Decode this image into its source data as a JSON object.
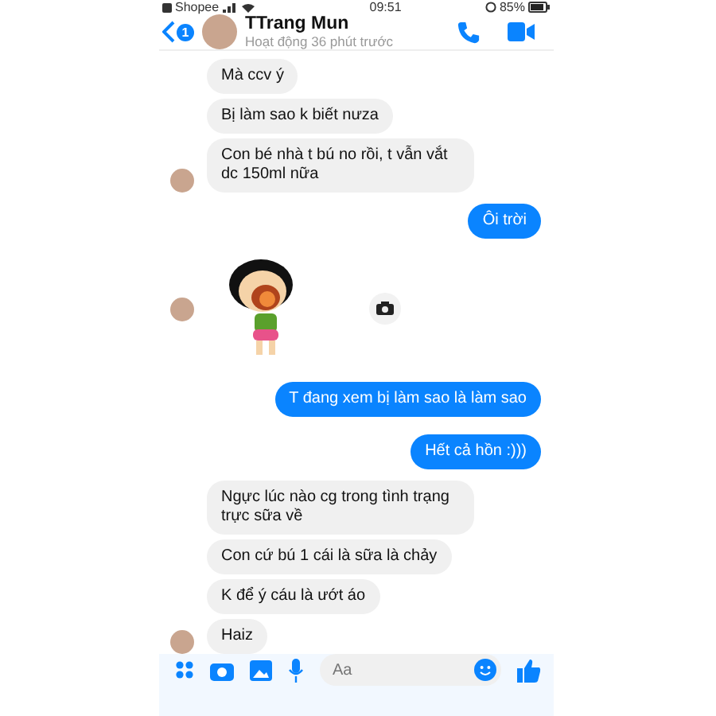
{
  "status_bar": {
    "carrier": "Shopee",
    "time": "09:51",
    "battery": "85%"
  },
  "header": {
    "unread_badge": "1",
    "name": "TTrang Mun",
    "status": "Hoạt động 36 phút trước"
  },
  "messages": [
    {
      "kind": "text",
      "sent": false,
      "avatar": false,
      "text": "Mà ccv ý"
    },
    {
      "kind": "text",
      "sent": false,
      "avatar": false,
      "text": "Bị làm sao k biết nưza"
    },
    {
      "kind": "text",
      "sent": false,
      "avatar": true,
      "text": "Con bé nhà t bú no rồi, t vẫn vắt dc 150ml nữa"
    },
    {
      "kind": "text",
      "sent": true,
      "text": "Ôi trời"
    },
    {
      "kind": "sticker",
      "sent": false,
      "avatar": true
    },
    {
      "kind": "text",
      "sent": true,
      "text": "T đang xem bị làm sao là làm sao"
    },
    {
      "kind": "text",
      "sent": true,
      "text": "Hết cả hồn :)))"
    },
    {
      "kind": "text",
      "sent": false,
      "avatar": false,
      "text": "Ngực lúc nào cg trong tình trạng trực sữa về"
    },
    {
      "kind": "text",
      "sent": false,
      "avatar": false,
      "text": "Con cứ bú 1 cái là sữa là chảy"
    },
    {
      "kind": "text",
      "sent": false,
      "avatar": false,
      "text": "K để ý cáu là ướt áo"
    },
    {
      "kind": "text",
      "sent": false,
      "avatar": true,
      "text": "Haiz"
    }
  ],
  "composer": {
    "placeholder": "Aa"
  }
}
